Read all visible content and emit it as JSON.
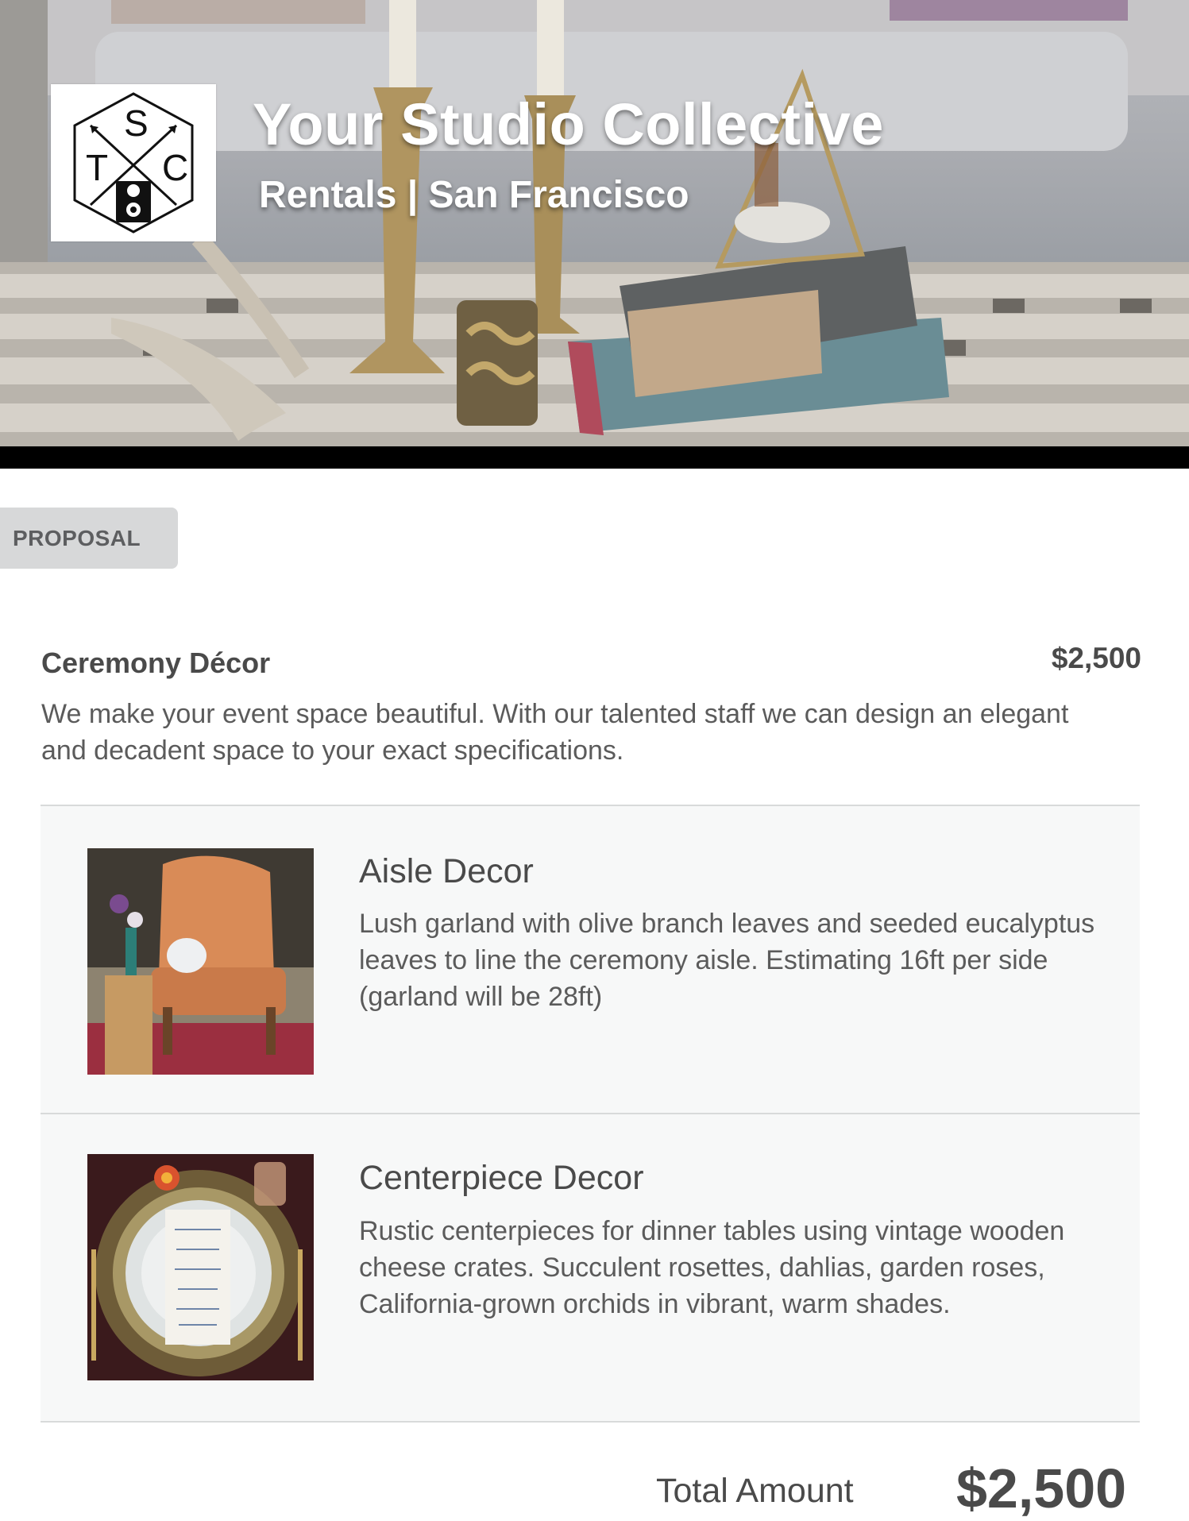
{
  "header": {
    "studio_name": "Your Studio Collective",
    "subtitle": "Rentals | San Francisco",
    "logo": {
      "letters": [
        "S",
        "T",
        "C"
      ],
      "icon": "camera-crossed-arrows-logo"
    }
  },
  "proposal_tag": "PROPOSAL",
  "section": {
    "title": "Ceremony Décor",
    "price": "$2,500",
    "description": "We make your event space beautiful. With our talented staff we can design an elegant and decadent space to your exact specifications."
  },
  "items": [
    {
      "name": "Aisle Decor",
      "description": "Lush garland with olive branch leaves and seeded eucalyptus leaves to line the ceremony aisle. Estimating 16ft per side (garland will be 28ft)",
      "image": "orange-tufted-chair-photo"
    },
    {
      "name": "Centerpiece Decor",
      "description": "Rustic centerpieces for dinner tables using vintage wooden cheese crates. Succulent rosettes, dahlias, garden roses, California-grown orchids in vibrant, warm shades.",
      "image": "table-place-setting-photo"
    }
  ],
  "total": {
    "label": "Total Amount",
    "value": "$2,500"
  },
  "colors": {
    "text": "#4a4a4a",
    "tag_bg": "#d7d8d9",
    "item_bg": "#f7f8f8",
    "divider": "#d8dada"
  }
}
